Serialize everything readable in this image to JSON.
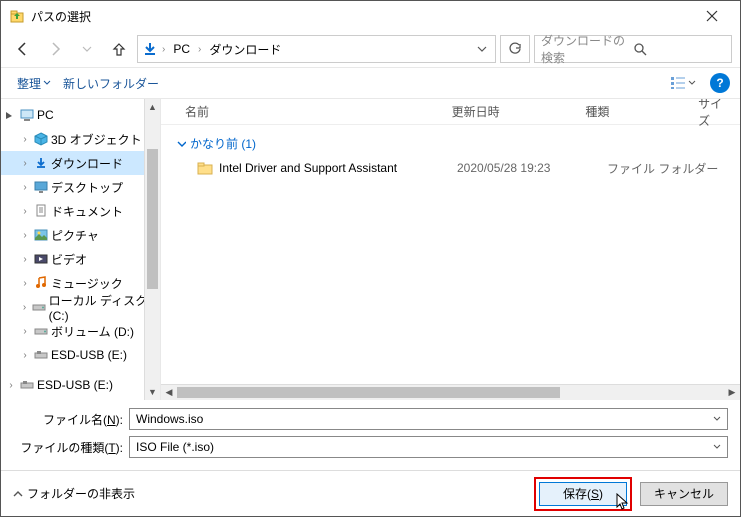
{
  "titlebar": {
    "title": "パスの選択"
  },
  "address": {
    "root": "PC",
    "current": "ダウンロード"
  },
  "search": {
    "placeholder": "ダウンロードの検索"
  },
  "toolbar": {
    "organize": "整理",
    "newfolder": "新しいフォルダー"
  },
  "columns": {
    "name": "名前",
    "date": "更新日時",
    "type": "種類",
    "size": "サイズ"
  },
  "sidebar": {
    "pc": "PC",
    "items": [
      {
        "label": "3D オブジェクト"
      },
      {
        "label": "ダウンロード"
      },
      {
        "label": "デスクトップ"
      },
      {
        "label": "ドキュメント"
      },
      {
        "label": "ピクチャ"
      },
      {
        "label": "ビデオ"
      },
      {
        "label": "ミュージック"
      },
      {
        "label": "ローカル ディスク (C:)"
      },
      {
        "label": "ボリューム (D:)"
      },
      {
        "label": "ESD-USB (E:)"
      },
      {
        "label": "ESD-USB (E:)"
      }
    ]
  },
  "filelist": {
    "group": "かなり前 (1)",
    "rows": [
      {
        "name": "Intel Driver and Support Assistant",
        "date": "2020/05/28 19:23",
        "type": "ファイル フォルダー"
      }
    ]
  },
  "inputs": {
    "filename_label": "ファイル名(N):",
    "filename_value": "Windows.iso",
    "filetype_label": "ファイルの種類(T):",
    "filetype_value": "ISO File (*.iso)"
  },
  "footer": {
    "hide": "フォルダーの非表示",
    "save": "保存(S)",
    "cancel": "キャンセル"
  }
}
